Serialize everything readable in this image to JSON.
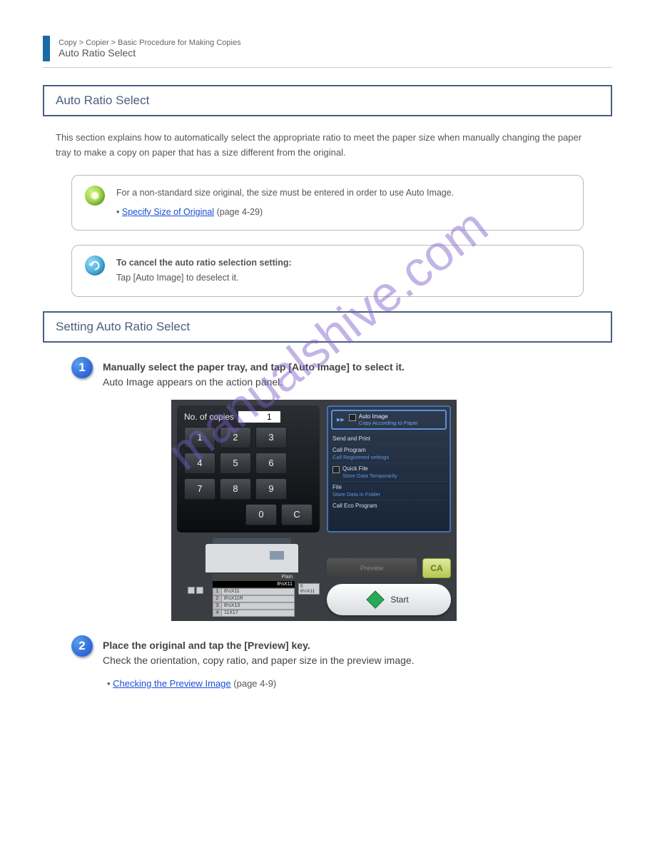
{
  "header": {
    "crumb": "Copy > Copier > Basic Procedure for Making Copies",
    "title": "Auto Ratio Select"
  },
  "sections": {
    "auto_ratio_select": "Auto Ratio Select",
    "intro": "This section explains how to automatically select the appropriate ratio to meet the paper size when manually changing the paper tray to make a copy on paper that has a size different from the original.",
    "setting_box_title": "Setting Auto Ratio Select"
  },
  "tip": {
    "line1": "For a non-standard size original, the size must be entered in order to use Auto Image.",
    "bullet_label": "Specify Size of Original",
    "bullet_link_id": "(page 4-29)"
  },
  "cancel": {
    "bold": "To cancel the auto ratio selection setting:",
    "body": "Tap [Auto Image] to deselect it."
  },
  "steps": {
    "s1": {
      "num": "1",
      "text": "Manually select the paper tray, and tap [Auto Image] to select it.",
      "sub": "Auto Image appears on the action panel."
    },
    "s2": {
      "num": "2",
      "text_bold": "Place the original and tap the [Preview] key.",
      "body": "Check the orientation, copy ratio, and paper size in the preview image.",
      "bullet_label": "Checking the Preview Image",
      "bullet_link_id": "(page 4-9)"
    }
  },
  "screenshot": {
    "copies_label": "No. of copies",
    "copies_value": "1",
    "keys": [
      "1",
      "2",
      "3",
      "4",
      "5",
      "6",
      "7",
      "8",
      "9",
      "0",
      "C"
    ],
    "side": {
      "hero_t1": "Auto Image",
      "hero_t2": "Copy According to Paper",
      "items": [
        {
          "t1": "Send and Print",
          "t2": ""
        },
        {
          "t1": "Call Program",
          "t2": "Call Registered settings"
        },
        {
          "t1": "Quick File",
          "t2": "Store Data Temporarily",
          "chk": true
        },
        {
          "t1": "File",
          "t2": "Store Data in Folder"
        },
        {
          "t1": "Call Eco Program",
          "t2": ""
        }
      ]
    },
    "trays": {
      "plain_label": "Plain",
      "plain_sel": "8½X11",
      "rows": [
        {
          "n": "1",
          "s": "8½X11"
        },
        {
          "n": "2",
          "s": "8½X11R"
        },
        {
          "n": "3",
          "s": "8½X13"
        },
        {
          "n": "4",
          "s": "11X17"
        }
      ],
      "side": [
        {
          "n": "5",
          "s": "8½X11"
        }
      ]
    },
    "buttons": {
      "preview": "Preview",
      "ca": "CA",
      "start": "Start"
    }
  },
  "watermark": "manualshive.com"
}
